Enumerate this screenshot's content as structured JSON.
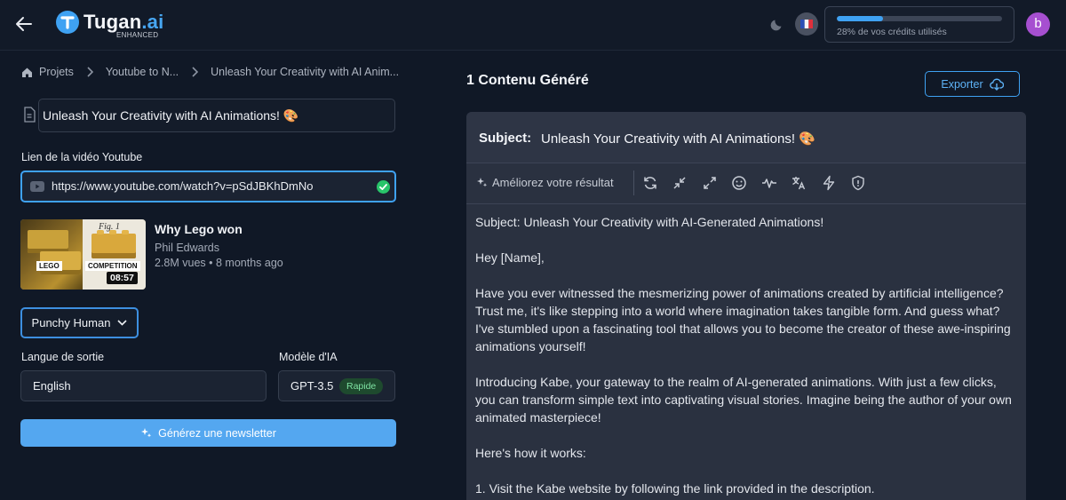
{
  "header": {
    "logo_text": "Tugan",
    "logo_accent": ".ai",
    "logo_sub": "ENHANCED",
    "credits_text": "28% de vos crédits utilisés",
    "credits_percent": 28,
    "avatar_letter": "b",
    "accent_color": "#3fa2f3"
  },
  "breadcrumb": {
    "items": [
      "Projets",
      "Youtube to N...",
      "Unleash Your Creativity with AI Anim..."
    ]
  },
  "form": {
    "title_value": "Unleash Your Creativity with AI Animations! 🎨",
    "youtube_label": "Lien de la vidéo Youtube",
    "youtube_url": "https://www.youtube.com/watch?v=pSdJBKhDmNo",
    "style_label": "Punchy Human",
    "language_label": "Langue de sortie",
    "language_value": "English",
    "model_label": "Modèle d'IA",
    "model_value": "GPT-3.5",
    "model_badge": "Rapide",
    "generate_label": "Générez une newsletter"
  },
  "video": {
    "title": "Why Lego won",
    "channel": "Phil Edwards",
    "meta": "2.8M vues • 8 months ago",
    "duration": "08:57",
    "thumb_left_label": "LEGO",
    "thumb_right_label": "COMPETITION",
    "thumb_caption": "Fig. 1"
  },
  "content": {
    "heading": "1 Contenu Généré",
    "export_label": "Exporter",
    "subject_label": "Subject:",
    "subject_value": "Unleash Your Creativity with AI Animations! 🎨",
    "improve_label": "Améliorez votre résultat",
    "paragraphs": [
      "Subject: Unleash Your Creativity with AI-Generated Animations!",
      "Hey [Name],",
      "Have you ever witnessed the mesmerizing power of animations created by artificial intelligence? Trust me, it's like stepping into a world where imagination takes tangible form. And guess what? I've stumbled upon a fascinating tool that allows you to become the creator of these awe-inspiring animations yourself!",
      "Introducing Kabe, your gateway to the realm of AI-generated animations. With just a few clicks, you can transform simple text into captivating visual stories. Imagine being the author of your own animated masterpiece!",
      "Here's how it works:",
      "1. Visit the Kabe website by following the link provided in the description."
    ]
  }
}
